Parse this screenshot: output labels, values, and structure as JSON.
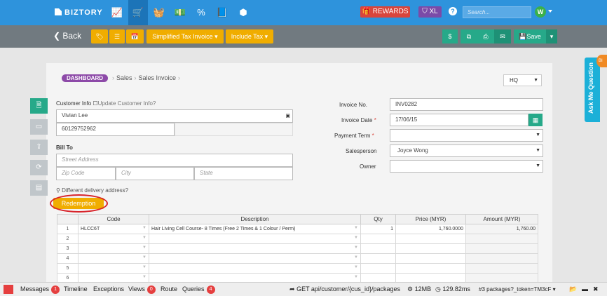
{
  "topbar": {
    "brand": "BIZTORY",
    "rewards": "REWARDS",
    "xl": "XL",
    "help": "?",
    "search_placeholder": "Search...",
    "avatar": "W",
    "nav": [
      {
        "icon": "chart-icon",
        "glyph": "📈"
      },
      {
        "icon": "cart-icon",
        "glyph": "🛒"
      },
      {
        "icon": "basket-icon",
        "glyph": "🧺"
      },
      {
        "icon": "money-icon",
        "glyph": "💵"
      },
      {
        "icon": "percent-icon",
        "glyph": "%"
      },
      {
        "icon": "book-icon",
        "glyph": "📘"
      },
      {
        "icon": "cubes-icon",
        "glyph": "⬢"
      }
    ]
  },
  "actionbar": {
    "back": "Back",
    "tax_type": "Simplified Tax Invoice",
    "tax_mode": "Include Tax",
    "save": "Save"
  },
  "breadcrumb": {
    "dashboard": "DASHBOARD",
    "sales": "Sales",
    "invoice": "Sales Invoice"
  },
  "branch": "HQ",
  "customer": {
    "label": "Customer Info",
    "update": "Update Customer Info?",
    "name": "Vivian Lee",
    "phone": "60129752962"
  },
  "bill_to": {
    "label": "Bill To",
    "street_placeholder": "Street Address",
    "zip_placeholder": "Zip Code",
    "city_placeholder": "City",
    "state_placeholder": "State"
  },
  "delivery": "Different delivery address?",
  "redemption": "Redemption",
  "invoice": {
    "no_label": "Invoice No.",
    "no": "INV0282",
    "date_label": "Invoice Date",
    "date": "17/06/15",
    "term_label": "Payment Term",
    "salesperson_label": "Salesperson",
    "salesperson": "Joyce Wong",
    "owner_label": "Owner",
    "required_mark": "*"
  },
  "table": {
    "headers": [
      "",
      "Code",
      "Description",
      "Qty",
      "Price (MYR)",
      "Amount (MYR)"
    ],
    "rows": [
      [
        "1",
        "HLCC6T",
        "Hair Living Cell Course- 8 Times (Free 2 Times & 1 Colour / Perm)",
        "1",
        "1,760.0000",
        "1,760.00"
      ],
      [
        "2",
        "",
        "",
        "",
        "",
        ""
      ],
      [
        "3",
        "",
        "",
        "",
        "",
        ""
      ],
      [
        "4",
        "",
        "",
        "",
        "",
        ""
      ],
      [
        "5",
        "",
        "",
        "",
        "",
        ""
      ],
      [
        "6",
        "",
        "",
        "",
        "",
        ""
      ]
    ]
  },
  "askme": "Ask Me Question",
  "corner_badge": "BI",
  "debugbar": {
    "messages": "Messages",
    "messages_count": "1",
    "timeline": "Timeline",
    "exceptions": "Exceptions",
    "views": "Views",
    "views_count": "0",
    "route": "Route",
    "queries": "Queries",
    "queries_count": "4",
    "request": "GET api/customer/{cus_id}/packages",
    "memory": "12MB",
    "time": "129.82ms",
    "package": "#3 packages?_token=TM3cF"
  }
}
